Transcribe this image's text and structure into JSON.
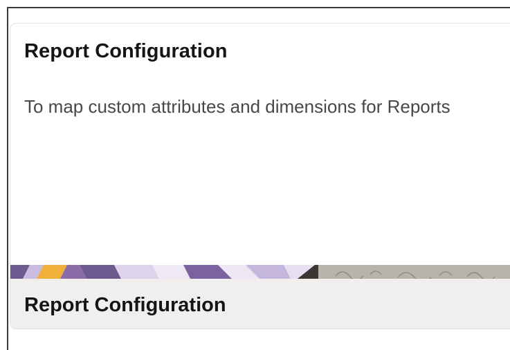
{
  "card": {
    "title": "Report Configuration",
    "description": "To map custom attributes and dimensions for Reports",
    "footer_title": "Report Configuration"
  },
  "colors": {
    "title_text": "#161513",
    "description_text": "#4a4745",
    "footer_bg": "#f1efed",
    "banner_orange": "#f0b03a",
    "banner_purple": "#6f5a8f",
    "banner_lavender": "#c9bddf",
    "banner_dark": "#3a3632",
    "banner_gray": "#b8b3ab"
  },
  "icons": {
    "banner": "decorative-pattern"
  }
}
